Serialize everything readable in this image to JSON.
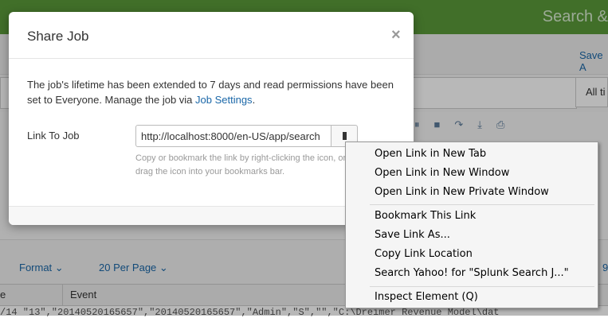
{
  "app": {
    "title": "Search &",
    "save_as": "Save A",
    "all_time": "All ti",
    "format": "Format ⌄",
    "per_page": "20 Per Page ⌄",
    "page_num": "9",
    "toolbar_icons": "⏸■↷⤓⎙",
    "table": {
      "col1": "e",
      "col2": "Event",
      "row_text": "/14   \"13\",\"20140520165657\",\"20140520165657\",\"Admin\",\"S\",\"\",\"C:\\Dreimer Revenue Model\\dat"
    }
  },
  "modal": {
    "title": "Share Job",
    "close": "×",
    "description": "The job's lifetime has been extended to 7 days and read permissions have been set to Everyone. Manage the job via ",
    "job_settings_link": "Job Settings",
    "description_end": ".",
    "link_label": "Link To Job",
    "link_value": "http://localhost:8000/en-US/app/search",
    "help": "Copy or bookmark the link by right-clicking the icon, or drag the icon into your bookmarks bar."
  },
  "context_menu": {
    "items": [
      "Open Link in New Tab",
      "Open Link in New Window",
      "Open Link in New Private Window",
      "Bookmark This Link",
      "Save Link As...",
      "Copy Link Location",
      "Search Yahoo! for \"Splunk Search J...\"",
      "Inspect Element (Q)"
    ]
  }
}
